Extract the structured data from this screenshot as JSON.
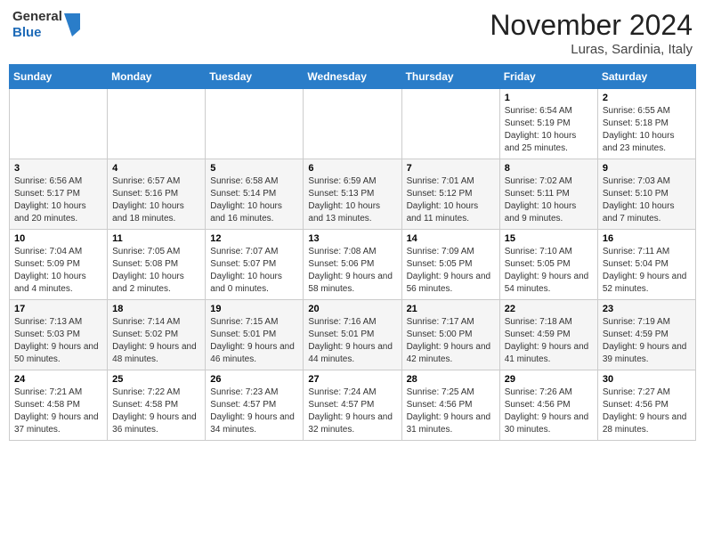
{
  "header": {
    "logo_general": "General",
    "logo_blue": "Blue",
    "month_title": "November 2024",
    "location": "Luras, Sardinia, Italy"
  },
  "days_of_week": [
    "Sunday",
    "Monday",
    "Tuesday",
    "Wednesday",
    "Thursday",
    "Friday",
    "Saturday"
  ],
  "weeks": [
    [
      {
        "day": "",
        "info": ""
      },
      {
        "day": "",
        "info": ""
      },
      {
        "day": "",
        "info": ""
      },
      {
        "day": "",
        "info": ""
      },
      {
        "day": "",
        "info": ""
      },
      {
        "day": "1",
        "info": "Sunrise: 6:54 AM\nSunset: 5:19 PM\nDaylight: 10 hours and 25 minutes."
      },
      {
        "day": "2",
        "info": "Sunrise: 6:55 AM\nSunset: 5:18 PM\nDaylight: 10 hours and 23 minutes."
      }
    ],
    [
      {
        "day": "3",
        "info": "Sunrise: 6:56 AM\nSunset: 5:17 PM\nDaylight: 10 hours and 20 minutes."
      },
      {
        "day": "4",
        "info": "Sunrise: 6:57 AM\nSunset: 5:16 PM\nDaylight: 10 hours and 18 minutes."
      },
      {
        "day": "5",
        "info": "Sunrise: 6:58 AM\nSunset: 5:14 PM\nDaylight: 10 hours and 16 minutes."
      },
      {
        "day": "6",
        "info": "Sunrise: 6:59 AM\nSunset: 5:13 PM\nDaylight: 10 hours and 13 minutes."
      },
      {
        "day": "7",
        "info": "Sunrise: 7:01 AM\nSunset: 5:12 PM\nDaylight: 10 hours and 11 minutes."
      },
      {
        "day": "8",
        "info": "Sunrise: 7:02 AM\nSunset: 5:11 PM\nDaylight: 10 hours and 9 minutes."
      },
      {
        "day": "9",
        "info": "Sunrise: 7:03 AM\nSunset: 5:10 PM\nDaylight: 10 hours and 7 minutes."
      }
    ],
    [
      {
        "day": "10",
        "info": "Sunrise: 7:04 AM\nSunset: 5:09 PM\nDaylight: 10 hours and 4 minutes."
      },
      {
        "day": "11",
        "info": "Sunrise: 7:05 AM\nSunset: 5:08 PM\nDaylight: 10 hours and 2 minutes."
      },
      {
        "day": "12",
        "info": "Sunrise: 7:07 AM\nSunset: 5:07 PM\nDaylight: 10 hours and 0 minutes."
      },
      {
        "day": "13",
        "info": "Sunrise: 7:08 AM\nSunset: 5:06 PM\nDaylight: 9 hours and 58 minutes."
      },
      {
        "day": "14",
        "info": "Sunrise: 7:09 AM\nSunset: 5:05 PM\nDaylight: 9 hours and 56 minutes."
      },
      {
        "day": "15",
        "info": "Sunrise: 7:10 AM\nSunset: 5:05 PM\nDaylight: 9 hours and 54 minutes."
      },
      {
        "day": "16",
        "info": "Sunrise: 7:11 AM\nSunset: 5:04 PM\nDaylight: 9 hours and 52 minutes."
      }
    ],
    [
      {
        "day": "17",
        "info": "Sunrise: 7:13 AM\nSunset: 5:03 PM\nDaylight: 9 hours and 50 minutes."
      },
      {
        "day": "18",
        "info": "Sunrise: 7:14 AM\nSunset: 5:02 PM\nDaylight: 9 hours and 48 minutes."
      },
      {
        "day": "19",
        "info": "Sunrise: 7:15 AM\nSunset: 5:01 PM\nDaylight: 9 hours and 46 minutes."
      },
      {
        "day": "20",
        "info": "Sunrise: 7:16 AM\nSunset: 5:01 PM\nDaylight: 9 hours and 44 minutes."
      },
      {
        "day": "21",
        "info": "Sunrise: 7:17 AM\nSunset: 5:00 PM\nDaylight: 9 hours and 42 minutes."
      },
      {
        "day": "22",
        "info": "Sunrise: 7:18 AM\nSunset: 4:59 PM\nDaylight: 9 hours and 41 minutes."
      },
      {
        "day": "23",
        "info": "Sunrise: 7:19 AM\nSunset: 4:59 PM\nDaylight: 9 hours and 39 minutes."
      }
    ],
    [
      {
        "day": "24",
        "info": "Sunrise: 7:21 AM\nSunset: 4:58 PM\nDaylight: 9 hours and 37 minutes."
      },
      {
        "day": "25",
        "info": "Sunrise: 7:22 AM\nSunset: 4:58 PM\nDaylight: 9 hours and 36 minutes."
      },
      {
        "day": "26",
        "info": "Sunrise: 7:23 AM\nSunset: 4:57 PM\nDaylight: 9 hours and 34 minutes."
      },
      {
        "day": "27",
        "info": "Sunrise: 7:24 AM\nSunset: 4:57 PM\nDaylight: 9 hours and 32 minutes."
      },
      {
        "day": "28",
        "info": "Sunrise: 7:25 AM\nSunset: 4:56 PM\nDaylight: 9 hours and 31 minutes."
      },
      {
        "day": "29",
        "info": "Sunrise: 7:26 AM\nSunset: 4:56 PM\nDaylight: 9 hours and 30 minutes."
      },
      {
        "day": "30",
        "info": "Sunrise: 7:27 AM\nSunset: 4:56 PM\nDaylight: 9 hours and 28 minutes."
      }
    ]
  ]
}
